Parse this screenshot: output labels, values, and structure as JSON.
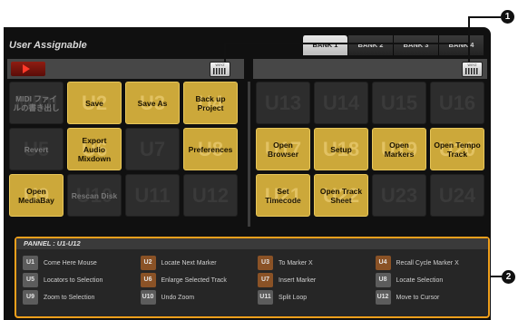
{
  "app": {
    "title": "User Assignable"
  },
  "banks": [
    "BANK 1",
    "BANK 2",
    "BANK 3",
    "BANK 4"
  ],
  "active_bank": "BANK 1",
  "keyboard_label": "WXYZ",
  "left_grid": [
    {
      "id": "MIDI",
      "label": "MIDI ファイルの書き出し",
      "active": false
    },
    {
      "id": "U2",
      "label": "Save",
      "active": true
    },
    {
      "id": "U3",
      "label": "Save As",
      "active": true
    },
    {
      "id": "U4",
      "label": "Back up Project",
      "active": true
    },
    {
      "id": "U5",
      "label": "Revert",
      "active": false
    },
    {
      "id": "U6",
      "label": "Export Audio Mixdown",
      "active": true
    },
    {
      "id": "U7",
      "label": "",
      "active": false
    },
    {
      "id": "U8",
      "label": "Preferences",
      "active": true
    },
    {
      "id": "U9",
      "label": "Open MediaBay",
      "active": true
    },
    {
      "id": "U10",
      "label": "Rescan Disk",
      "active": false
    },
    {
      "id": "U11",
      "label": "",
      "active": false
    },
    {
      "id": "U12",
      "label": "",
      "active": false
    }
  ],
  "right_grid": [
    {
      "id": "U13",
      "label": "",
      "active": false
    },
    {
      "id": "U14",
      "label": "",
      "active": false
    },
    {
      "id": "U15",
      "label": "",
      "active": false
    },
    {
      "id": "U16",
      "label": "",
      "active": false
    },
    {
      "id": "U17",
      "label": "Open Browser",
      "active": true
    },
    {
      "id": "U18",
      "label": "Setup",
      "active": true
    },
    {
      "id": "U19",
      "label": "Open Markers",
      "active": true
    },
    {
      "id": "U20",
      "label": "Open Tempo Track",
      "active": true
    },
    {
      "id": "U21",
      "label": "Set Timecode",
      "active": true
    },
    {
      "id": "U22",
      "label": "Open Track Sheet",
      "active": true
    },
    {
      "id": "U23",
      "label": "",
      "active": false
    },
    {
      "id": "U24",
      "label": "",
      "active": false
    }
  ],
  "panel": {
    "title": "PANNEL : U1-U12",
    "items": [
      {
        "badge": "U1",
        "label": "Come Here Mouse",
        "color": "gray"
      },
      {
        "badge": "U2",
        "label": "Locate Next Marker",
        "color": "brown"
      },
      {
        "badge": "U3",
        "label": "To Marker X",
        "color": "brown"
      },
      {
        "badge": "U4",
        "label": "Recall Cycle Marker X",
        "color": "brown"
      },
      {
        "badge": "U5",
        "label": "Locators to Selection",
        "color": "gray"
      },
      {
        "badge": "U6",
        "label": "Enlarge Selected Track",
        "color": "brown"
      },
      {
        "badge": "U7",
        "label": "Insert Marker",
        "color": "brown"
      },
      {
        "badge": "U8",
        "label": "Locate Selection",
        "color": "gray"
      },
      {
        "badge": "U9",
        "label": "Zoom to Selection",
        "color": "gray"
      },
      {
        "badge": "U10",
        "label": "Undo Zoom",
        "color": "gray"
      },
      {
        "badge": "U11",
        "label": "Split Loop",
        "color": "gray"
      },
      {
        "badge": "U12",
        "label": "Move to Cursor",
        "color": "gray"
      }
    ]
  },
  "callouts": [
    "1",
    "2"
  ],
  "colors": {
    "accent_gold": "#cca83a",
    "panel_border": "#f1a01c",
    "record_red": "#ff3a2a"
  }
}
